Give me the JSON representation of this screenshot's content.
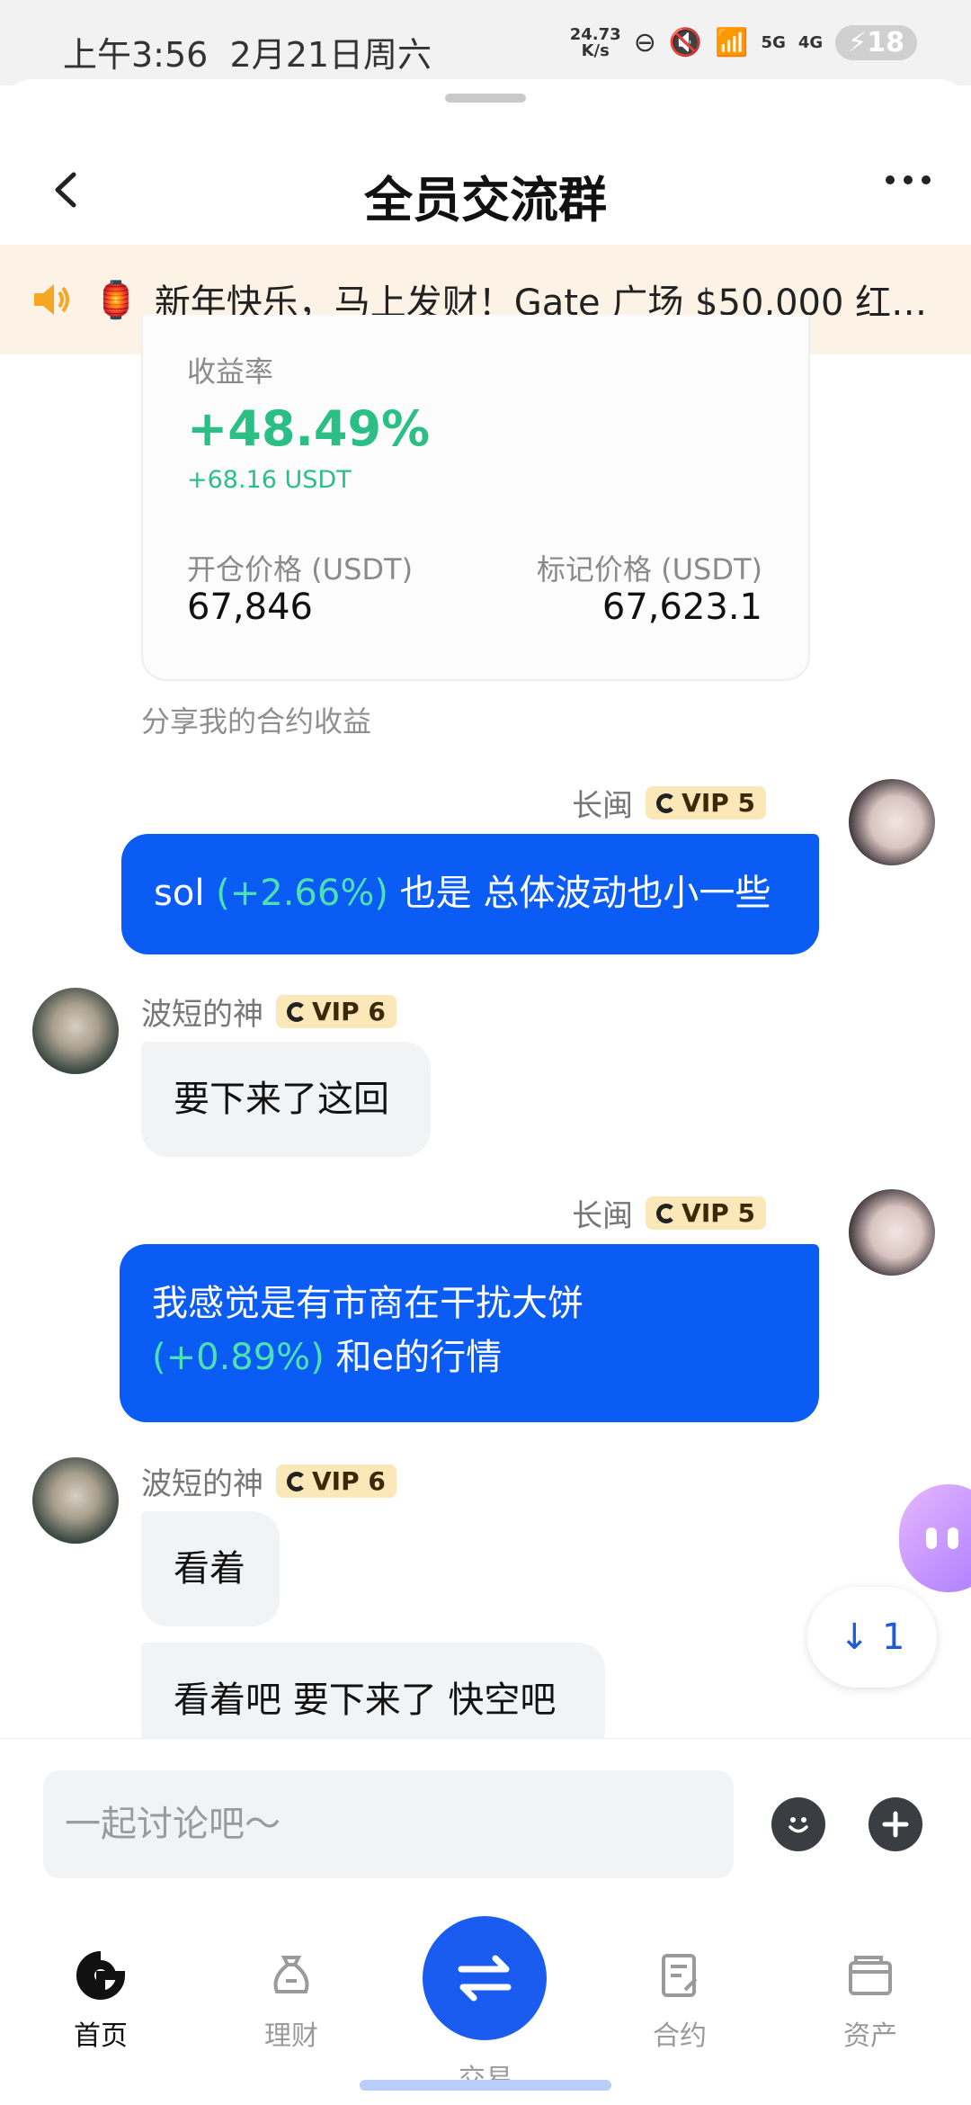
{
  "status_bar": {
    "time": "上午3:56",
    "date": "2月21日周六",
    "net_speed_value": "24.73",
    "net_speed_unit": "K/s",
    "signal_5g": "5G",
    "signal_4g": "4G",
    "battery": "18"
  },
  "header": {
    "title": "全员交流群"
  },
  "announcement": {
    "text": "新年快乐，马上发财！Gate 广场 $50,000 红…"
  },
  "card": {
    "yield_label": "收益率",
    "yield_value": "+48.49%",
    "profit": "+68.16 USDT",
    "open_price_label": "开仓价格 (USDT)",
    "open_price_value": "67,846",
    "mark_price_label": "标记价格 (USDT)",
    "mark_price_value": "67,623.1",
    "share_label": "分享我的合约收益"
  },
  "messages": {
    "m1": {
      "user": "长闽",
      "vip": "VIP 5",
      "text_a": "sol ",
      "pct": "(+2.66%)",
      "text_b": " 也是 总体波动也小一些"
    },
    "m2": {
      "user": "波短的神",
      "vip": "VIP 6",
      "text": "要下来了这回"
    },
    "m3": {
      "user": "长闽",
      "vip": "VIP 5",
      "line1": "我感觉是有市商在干扰大饼",
      "pct": "(+0.89%)",
      "line2": " 和e的行情"
    },
    "m4": {
      "user": "波短的神",
      "vip": "VIP 6",
      "text1": "看着",
      "text2": "看着吧 要下来了 快空吧"
    }
  },
  "scroll_down": {
    "count": "1"
  },
  "composer": {
    "placeholder": "一起讨论吧～"
  },
  "nav": {
    "home": "首页",
    "finance": "理财",
    "trade": "交易",
    "contract": "合约",
    "assets": "资产"
  },
  "colors": {
    "brand_blue": "#0a5cf5",
    "profit_green": "#2bbf86",
    "vip_gold": "#fbe7b7"
  }
}
